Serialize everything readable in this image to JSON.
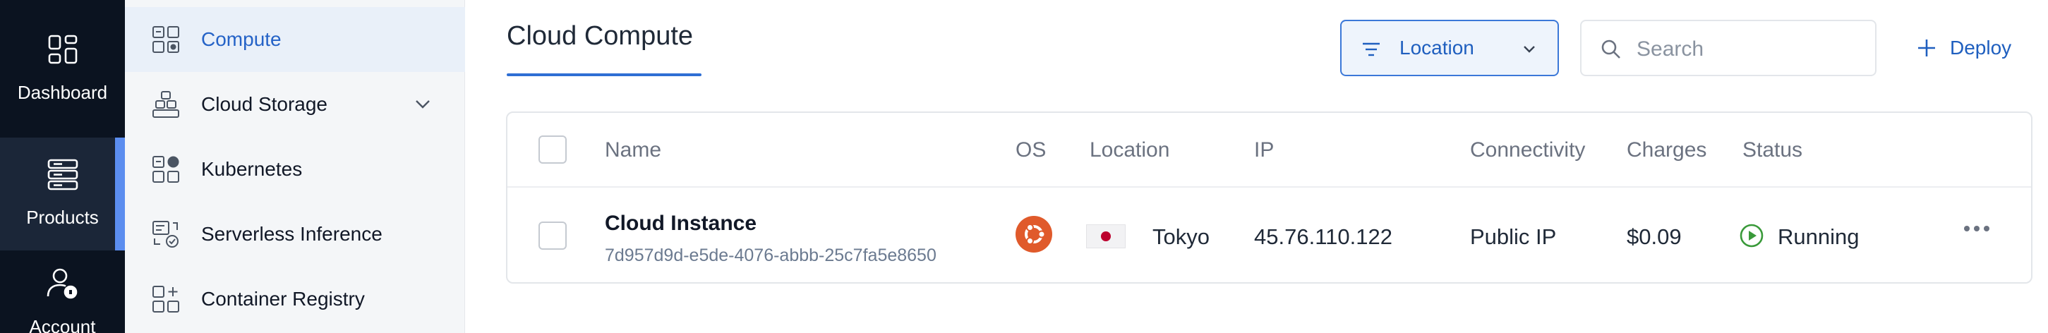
{
  "rail": {
    "items": [
      {
        "label": "Dashboard",
        "icon": "dashboard-grid-icon"
      },
      {
        "label": "Products",
        "icon": "server-stack-icon",
        "active": true
      },
      {
        "label": "Account",
        "icon": "user-lock-icon"
      }
    ]
  },
  "sidebar": {
    "items": [
      {
        "label": "Compute",
        "icon": "compute-icon",
        "active": true
      },
      {
        "label": "Cloud Storage",
        "icon": "storage-icon",
        "has_chevron": true
      },
      {
        "label": "Kubernetes",
        "icon": "kubernetes-icon"
      },
      {
        "label": "Serverless Inference",
        "icon": "serverless-icon"
      },
      {
        "label": "Container Registry",
        "icon": "container-registry-icon"
      }
    ]
  },
  "main": {
    "title": "Cloud Compute",
    "location_filter": {
      "label": "Location",
      "icon": "filter-icon"
    },
    "search": {
      "placeholder": "Search",
      "value": ""
    },
    "deploy": {
      "label": "Deploy",
      "icon": "plus-icon"
    }
  },
  "table": {
    "columns": [
      "Name",
      "OS",
      "Location",
      "IP",
      "Connectivity",
      "Charges",
      "Status"
    ],
    "rows": [
      {
        "name": "Cloud Instance",
        "id": "7d957d9d-e5de-4076-abbb-25c7fa5e8650",
        "os": "ubuntu-logo-icon",
        "location": "Tokyo",
        "flag": "japan-flag-icon",
        "ip": "45.76.110.122",
        "connectivity": "Public IP",
        "charges": "$0.09",
        "status": "Running"
      }
    ]
  },
  "colors": {
    "accent": "#2f6fd4",
    "rail_bg": "#0b1320",
    "status_running": "#3a9a3a",
    "ubuntu": "#e05a2b"
  }
}
